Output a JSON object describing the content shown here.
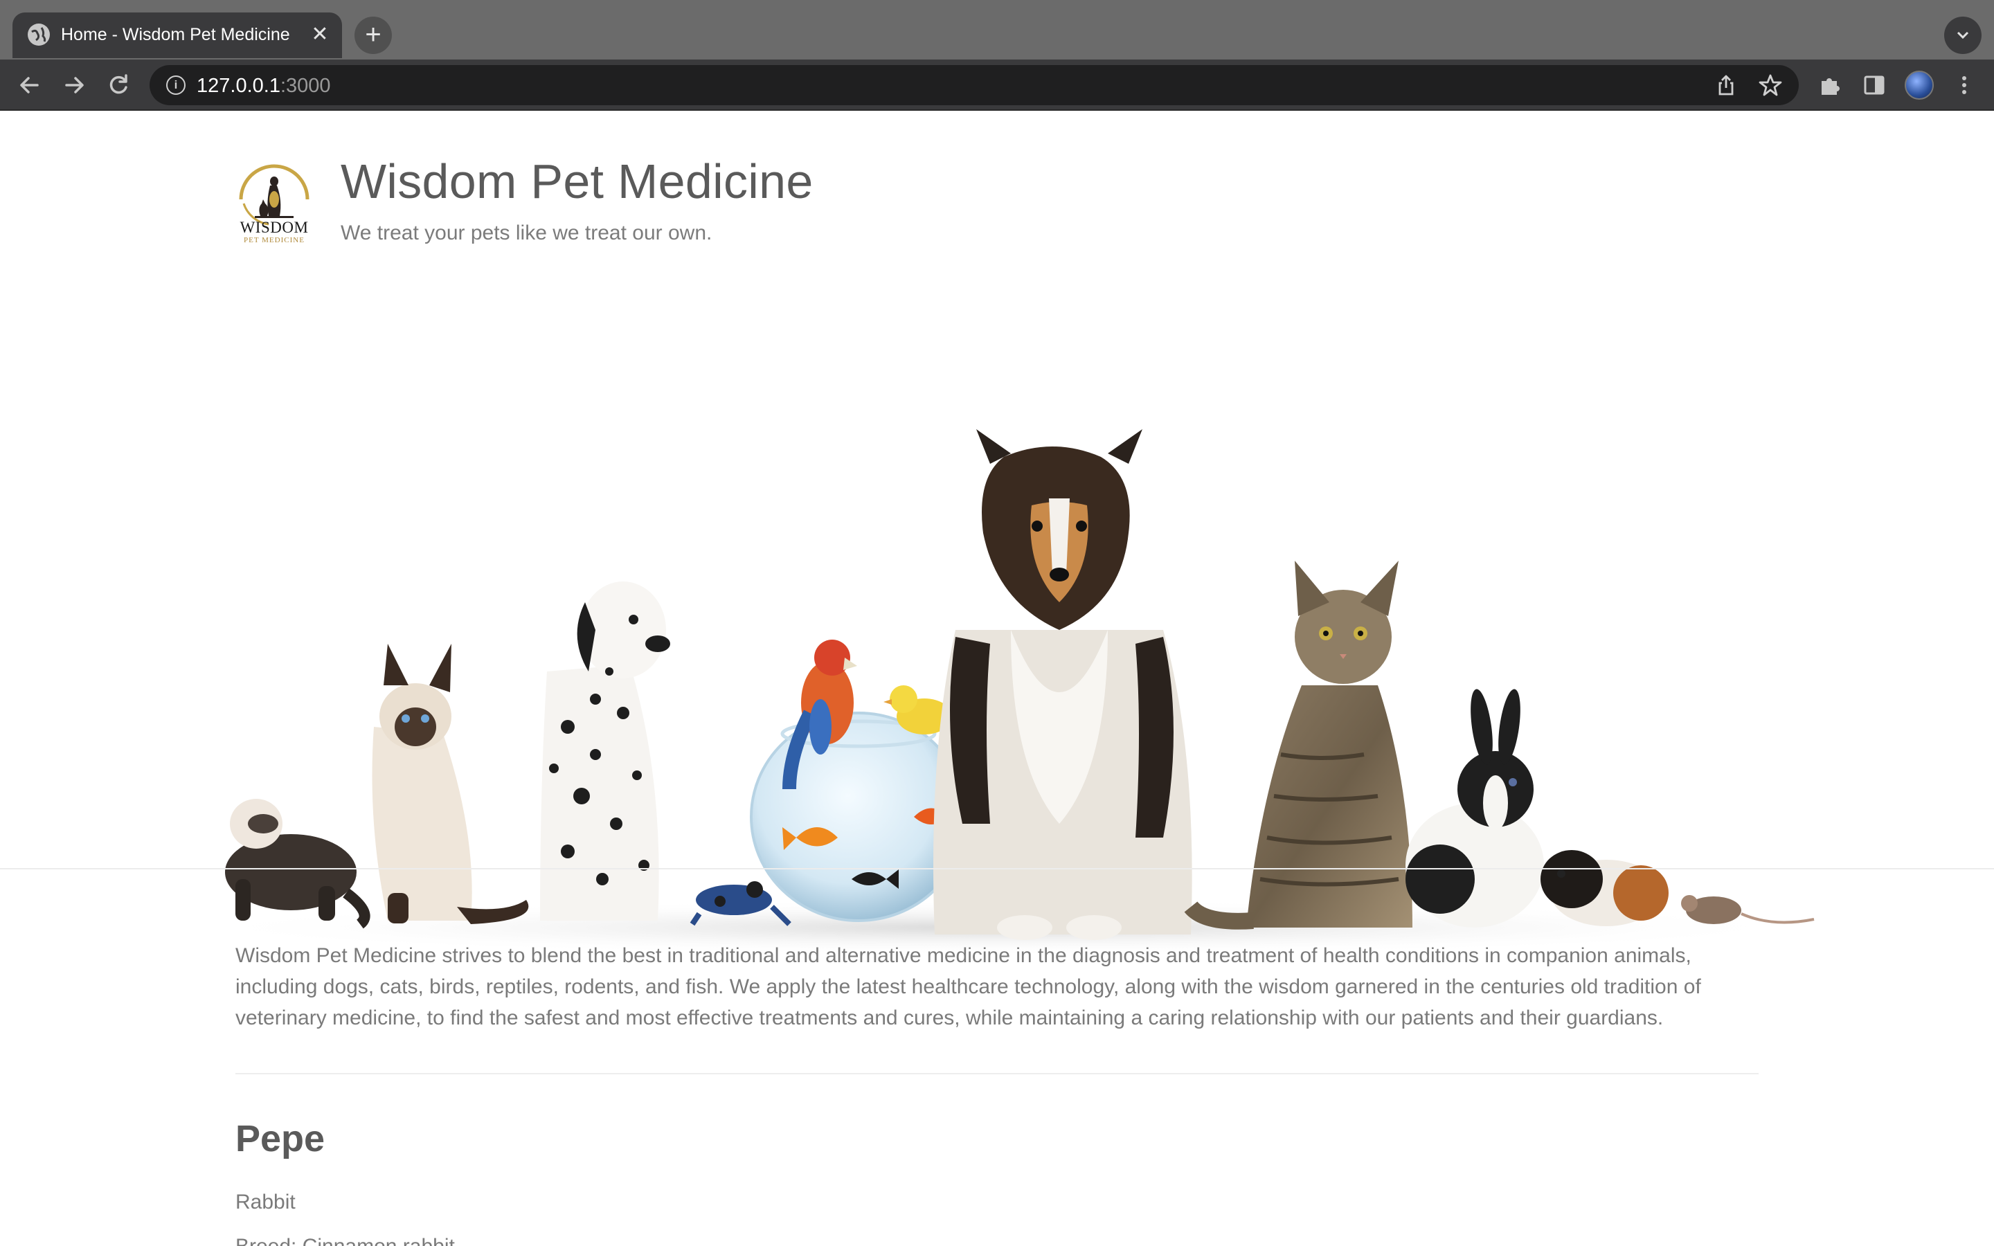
{
  "browser": {
    "tab_title": "Home - Wisdom Pet Medicine",
    "tab_close": "✕",
    "new_tab": "+",
    "url_host": "127.0.0.1",
    "url_port": ":3000",
    "icons": [
      "globe-icon",
      "close-icon",
      "plus-icon",
      "chevron-down-icon",
      "back-arrow-icon",
      "forward-arrow-icon",
      "reload-icon",
      "info-icon",
      "share-icon",
      "bookmark-star-icon",
      "extensions-puzzle-icon",
      "side-panel-icon",
      "profile-avatar",
      "kebab-menu-icon"
    ]
  },
  "header": {
    "logo_alt": "Wisdom Pet Medicine logo",
    "title": "Wisdom Pet Medicine",
    "tagline": "We treat your pets like we treat our own."
  },
  "hero": {
    "alt": "Group of pets: ferret, siamese cat, dalmatian, frog, parrot, fishbowl with goldfish, canary, collie, tabby cat, rabbit, guinea pig, mouse"
  },
  "main": {
    "intro": "Wisdom Pet Medicine strives to blend the best in traditional and alternative medicine in the diagnosis and treatment of health conditions in companion animals, including dogs, cats, birds, reptiles, rodents, and fish. We apply the latest healthcare technology, along with the wisdom garnered in the centuries old tradition of veterinary medicine, to find the safest and most effective treatments and cures, while maintaining a caring relationship with our patients and their guardians.",
    "pet": {
      "name": "Pepe",
      "species": "Rabbit",
      "breed": "Breed: Cinnamon rabbit"
    }
  },
  "colors": {
    "chrome_tabbar": "#6b6b6b",
    "chrome_toolbar": "#3a3a3c",
    "omnibox": "#1f1f20",
    "title_text": "#5a5a5a",
    "body_text": "#7a7a7a",
    "logo_gold": "#c9a646"
  }
}
